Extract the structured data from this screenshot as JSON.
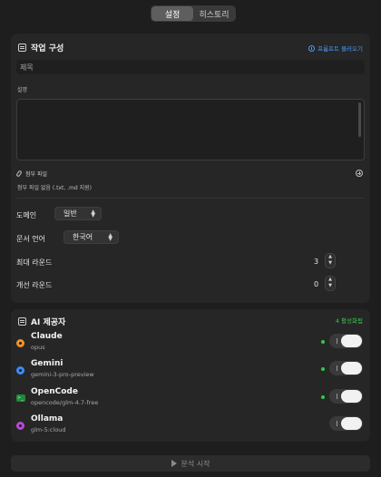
{
  "tabs": [
    {
      "label": "설정",
      "active": true
    },
    {
      "label": "히스토리",
      "active": false
    }
  ],
  "task": {
    "title": "작업 구성",
    "load_prompt": "프롬프트 불러오기",
    "title_placeholder": "제목",
    "description_label": "설명",
    "attach_label": "첨부 파일",
    "attach_empty": "첨부 파일 없음 (.txt, .md 지원)",
    "domain_label": "도메인",
    "domain_value": "일반",
    "language_label": "문서 언어",
    "language_value": "한국어",
    "max_rounds_label": "최대 라운드",
    "max_rounds_value": "3",
    "improve_rounds_label": "개선 라운드",
    "improve_rounds_value": "0"
  },
  "ai": {
    "title": "AI 제공자",
    "active_count": "4 활성화됨",
    "providers": [
      {
        "name": "Claude",
        "model": "opus",
        "color": "#f0932b",
        "icon": "claude-icon",
        "enabled": true
      },
      {
        "name": "Gemini",
        "model": "gemini-3-pro-preview",
        "color": "#3d8bf2",
        "icon": "gemini-icon",
        "enabled": true
      },
      {
        "name": "OpenCode",
        "model": "opencode/glm-4.7-free",
        "color": "#1f8a3a",
        "icon": "terminal-icon",
        "enabled": true
      },
      {
        "name": "Ollama",
        "model": "glm-5:cloud",
        "color": "#b84ad6",
        "icon": "ollama-icon",
        "enabled": true
      }
    ]
  },
  "run": {
    "label": "분석 시작"
  }
}
